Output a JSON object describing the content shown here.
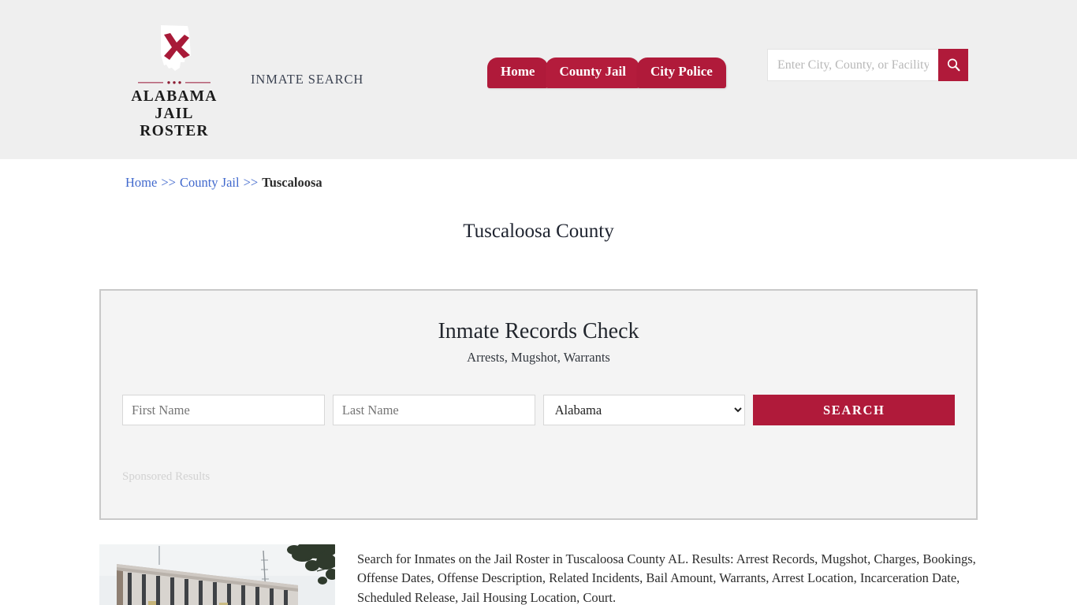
{
  "header": {
    "logo": {
      "line1": "ALABAMA",
      "line2": "JAIL ROSTER",
      "mark_icon": "alabama-state-flag-icon"
    },
    "tagline": "INMATE SEARCH",
    "nav": [
      {
        "label": "Home"
      },
      {
        "label": "County Jail"
      },
      {
        "label": "City Police"
      }
    ],
    "search": {
      "placeholder": "Enter City, County, or Facility",
      "value": "",
      "button_icon": "search-icon"
    }
  },
  "breadcrumb": {
    "items": [
      {
        "label": "Home",
        "link": true
      },
      {
        "label": "County Jail",
        "link": true
      },
      {
        "label": "Tuscaloosa",
        "link": false
      }
    ],
    "separator": ">>"
  },
  "page_title": "Tuscaloosa County",
  "panel": {
    "title": "Inmate Records Check",
    "subtitle": "Arrests, Mugshot, Warrants",
    "form": {
      "first_name_placeholder": "First Name",
      "first_name_value": "",
      "last_name_placeholder": "Last Name",
      "last_name_value": "",
      "state_selected": "Alabama",
      "state_options": [
        "Alabama"
      ],
      "search_label": "SEARCH"
    },
    "sponsored_label": "Sponsored Results"
  },
  "content": {
    "image_alt": "tuscaloosa-county-jail-building-photo",
    "paragraph": "Search for Inmates on the Jail Roster in Tuscaloosa County AL. Results: Arrest Records, Mugshot, Charges, Bookings, Offense Dates, Offense Description, Related Incidents, Bail Amount, Warrants, Arrest Location, Incarceration Date, Scheduled Release, Jail Housing Location, Court."
  },
  "colors": {
    "crimson": "#b01a3a",
    "header_bg": "#efefef",
    "panel_bg": "#f4f4f4",
    "link_blue": "#4169cd"
  }
}
